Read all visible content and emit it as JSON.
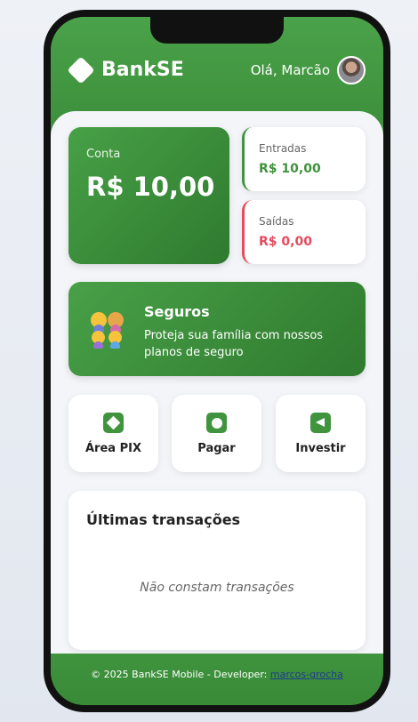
{
  "app": {
    "brand": "BankSE",
    "greeting": "Olá, Marcão"
  },
  "balance": {
    "label": "Conta",
    "value": "R$ 10,00"
  },
  "income": {
    "label": "Entradas",
    "value": "R$ 10,00"
  },
  "expenses": {
    "label": "Saídas",
    "value": "R$ 0,00"
  },
  "insurance": {
    "title": "Seguros",
    "description": "Proteja sua família com nossos planos de seguro",
    "icon": "family-icon"
  },
  "actions": [
    {
      "label": "Área PIX",
      "icon": "diamond-icon"
    },
    {
      "label": "Pagar",
      "icon": "circle-icon"
    },
    {
      "label": "Investir",
      "icon": "play-back-icon"
    }
  ],
  "transactions": {
    "title": "Últimas transações",
    "empty": "Não constam transações"
  },
  "footer": {
    "text": "© 2025 BankSE Mobile - Developer: ",
    "link": "marcos-grocha"
  },
  "colors": {
    "primary": "#3f943d",
    "danger": "#e54b5e"
  }
}
